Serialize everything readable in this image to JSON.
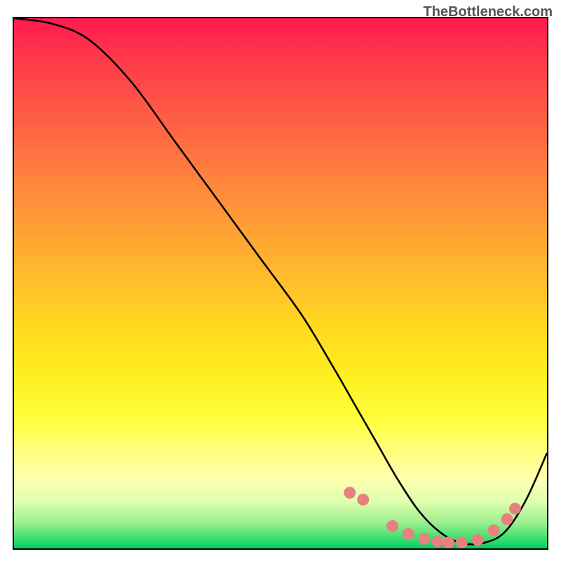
{
  "watermark": "TheBottleneck.com",
  "chart_data": {
    "type": "line",
    "title": "",
    "xlabel": "",
    "ylabel": "",
    "xlim": [
      0,
      100
    ],
    "ylim": [
      0,
      100
    ],
    "series": [
      {
        "name": "curve",
        "x": [
          0,
          7,
          14,
          22,
          30,
          38,
          46,
          54,
          60,
          64,
          68,
          72,
          76,
          80,
          84,
          88,
          92,
          96,
          100
        ],
        "y": [
          100,
          99,
          96,
          88,
          77,
          66,
          55,
          44,
          34,
          27,
          20,
          13,
          7,
          3,
          1,
          1,
          3,
          9,
          18
        ]
      }
    ],
    "markers": {
      "name": "salmon-dots",
      "color": "#e98080",
      "x": [
        63,
        65.5,
        71,
        74,
        77,
        79.5,
        81.5,
        84,
        87,
        90,
        92.5,
        94
      ],
      "y": [
        10.5,
        9.2,
        4.2,
        2.7,
        1.8,
        1.3,
        1.1,
        1.1,
        1.6,
        3.4,
        5.5,
        7.5
      ]
    }
  }
}
